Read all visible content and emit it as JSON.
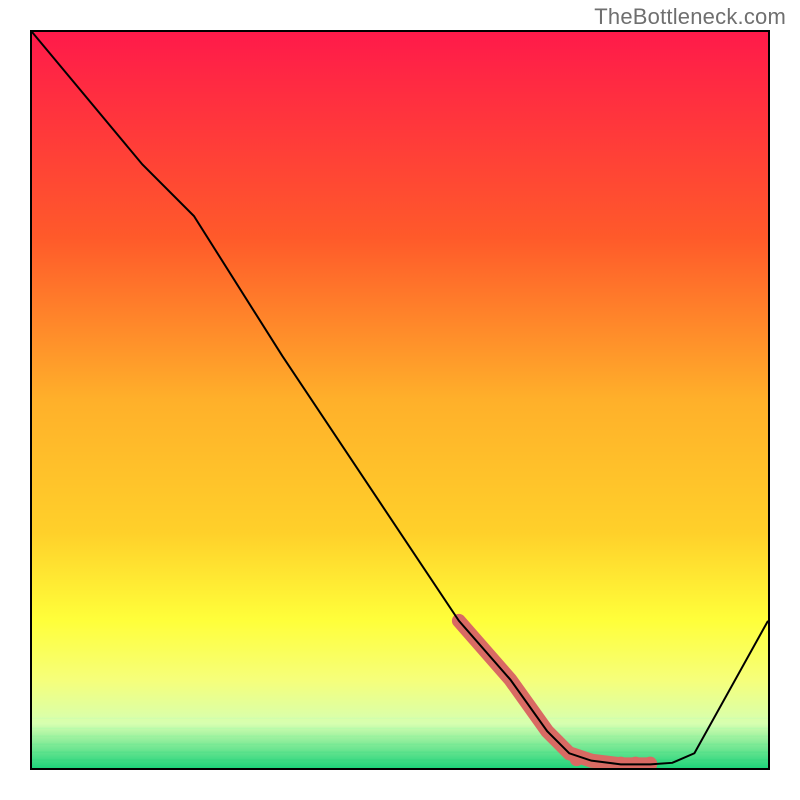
{
  "watermark": "TheBottleneck.com",
  "colors": {
    "border": "#000000",
    "line": "#000000",
    "highlight": "#d96a63",
    "grad_top": "#ff1a4a",
    "grad_mid1": "#ff6a2a",
    "grad_mid2": "#ffd02a",
    "grad_mid3": "#ffff3a",
    "grad_mid4": "#f6ff7a",
    "grad_mid5": "#d6ffb0",
    "grad_bottom": "#1fd37a"
  },
  "chart_data": {
    "type": "line",
    "title": "",
    "xlabel": "",
    "ylabel": "",
    "xlim": [
      0,
      100
    ],
    "ylim": [
      0,
      100
    ],
    "grid": false,
    "note": "Axes are unlabeled in the source image; values are estimated positions on a 0–100 scale (y increases upward).",
    "series": [
      {
        "name": "curve",
        "x": [
          0,
          5,
          15,
          22,
          34,
          46,
          58,
          65,
          70,
          73,
          76,
          80,
          84,
          87,
          90,
          100
        ],
        "y": [
          100,
          94,
          82,
          75,
          56,
          38,
          20,
          12,
          5,
          2,
          1,
          0.5,
          0.5,
          0.7,
          2,
          20
        ]
      }
    ],
    "highlight_segment": {
      "name": "bottom-highlight",
      "x": [
        58,
        65,
        70,
        73,
        76,
        80,
        84
      ],
      "y": [
        20,
        12,
        5,
        2,
        1,
        0.5,
        0.5
      ]
    },
    "highlight_dots": {
      "name": "bottom-dots",
      "x": [
        74,
        76,
        80,
        82,
        84
      ],
      "y": [
        1.2,
        1.0,
        0.6,
        0.6,
        0.6
      ]
    }
  }
}
